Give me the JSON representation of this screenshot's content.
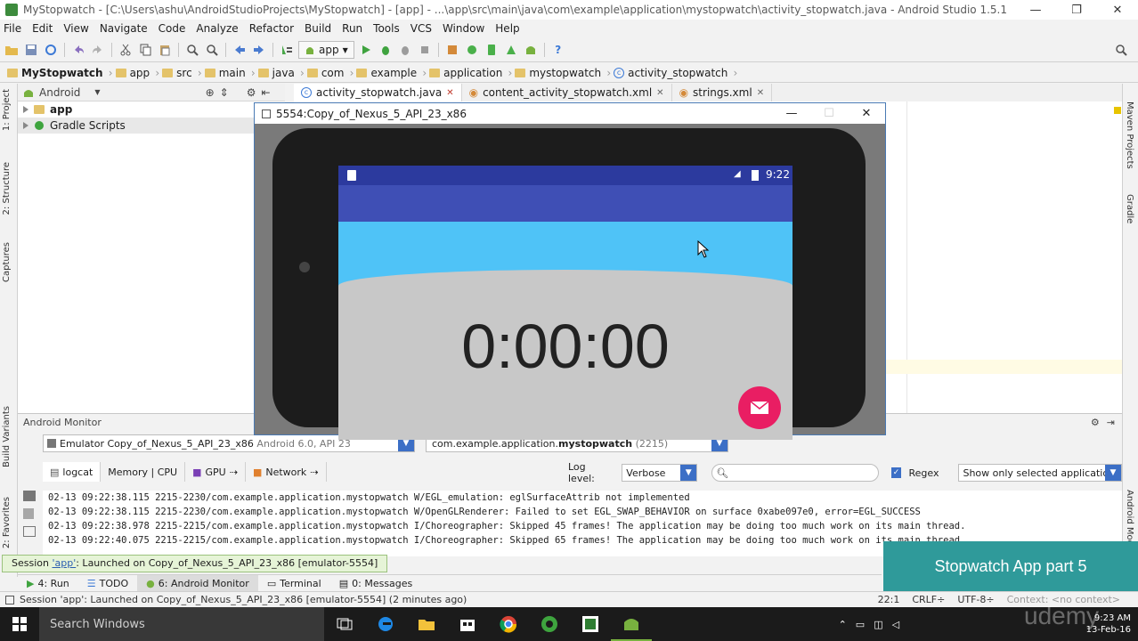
{
  "window": {
    "title": "MyStopwatch - [C:\\Users\\ashu\\AndroidStudioProjects\\MyStopwatch] - [app] - ...\\app\\src\\main\\java\\com\\example\\application\\mystopwatch\\activity_stopwatch.java - Android Studio 1.5.1",
    "minimize": "—",
    "restore": "❐",
    "close": "✕"
  },
  "menu": [
    "File",
    "Edit",
    "View",
    "Navigate",
    "Code",
    "Analyze",
    "Refactor",
    "Build",
    "Run",
    "Tools",
    "VCS",
    "Window",
    "Help"
  ],
  "toolbar": {
    "run_config": "app"
  },
  "breadcrumbs": [
    "MyStopwatch",
    "app",
    "src",
    "main",
    "java",
    "com",
    "example",
    "application",
    "mystopwatch",
    "activity_stopwatch"
  ],
  "project": {
    "view_mode": "Android",
    "tree": [
      "app",
      "Gradle Scripts"
    ]
  },
  "editor_tabs": [
    {
      "label": "activity_stopwatch.java",
      "active": true
    },
    {
      "label": "content_activity_stopwatch.xml",
      "active": false
    },
    {
      "label": "strings.xml",
      "active": false
    }
  ],
  "left_tool_tabs": [
    "1: Project",
    "2: Structure",
    "Captures",
    "Build Variants",
    "2: Favorites"
  ],
  "right_tool_tabs": [
    "Maven Projects",
    "Gradle",
    "Android Model"
  ],
  "emulator": {
    "title": "5554:Copy_of_Nexus_5_API_23_x86",
    "status_time": "9:22",
    "timer": "0:00:00"
  },
  "monitor": {
    "title": "Android Monitor",
    "device": "Emulator Copy_of_Nexus_5_API_23_x86",
    "device_api": "Android 6.0, API 23",
    "process_pkg": "com.example.application.",
    "process_bold": "mystopwatch",
    "process_pid": "(2215)",
    "tabs": [
      "logcat",
      "Memory | CPU",
      "GPU",
      "Network"
    ],
    "log_level_label": "Log level:",
    "log_level": "Verbose",
    "regex_label": "Regex",
    "filter": "Show only selected application",
    "log_lines": [
      "02-13 09:22:38.115 2215-2230/com.example.application.mystopwatch W/EGL_emulation: eglSurfaceAttrib not implemented",
      "02-13 09:22:38.115 2215-2230/com.example.application.mystopwatch W/OpenGLRenderer: Failed to set EGL_SWAP_BEHAVIOR on surface 0xabe097e0, error=EGL_SUCCESS",
      "02-13 09:22:38.978 2215-2215/com.example.application.mystopwatch I/Choreographer: Skipped 45 frames!  The application may be doing too much work on its main thread.",
      "02-13 09:22:40.075 2215-2215/com.example.application.mystopwatch I/Choreographer: Skipped 65 frames!  The application may be doing too much work on its main thread."
    ]
  },
  "session_tip": {
    "prefix": "Session ",
    "link": "'app'",
    "suffix": ": Launched on Copy_of_Nexus_5_API_23_x86 [emulator-5554]"
  },
  "tool_tabs": [
    {
      "label": "4: Run",
      "active": false
    },
    {
      "label": "TODO",
      "active": false
    },
    {
      "label": "6: Android Monitor",
      "active": true
    },
    {
      "label": "Terminal",
      "active": false
    },
    {
      "label": "0: Messages",
      "active": false
    }
  ],
  "overlay_caption": "Stopwatch App part 5",
  "status": {
    "message": "Session 'app': Launched on Copy_of_Nexus_5_API_23_x86 [emulator-5554] (2 minutes ago)",
    "position": "22:1",
    "line_sep": "CRLF÷",
    "encoding": "UTF-8÷",
    "context": "Context: <no context>"
  },
  "taskbar": {
    "search_placeholder": "Search Windows",
    "time": "9:23 AM",
    "date": "13-Feb-16"
  },
  "watermark": "udemy",
  "colors": {
    "status_bar": "#2c3a9e",
    "app_bar": "#3f4fb5",
    "accent_blue": "#4fc3f7",
    "fab": "#e91e63",
    "overlay": "#2f9a9a"
  }
}
